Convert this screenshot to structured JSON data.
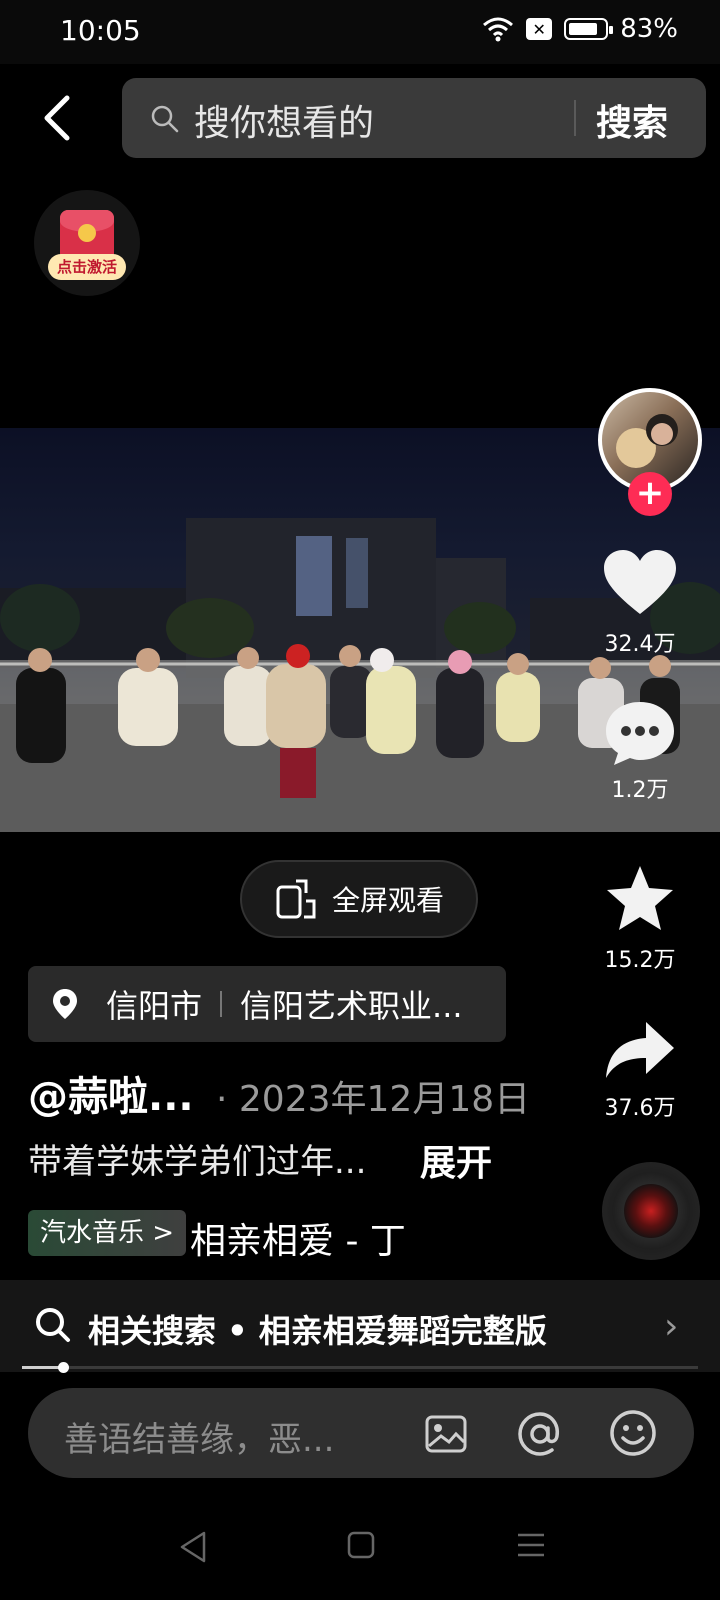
{
  "status_bar": {
    "time": "10:05",
    "battery_percent_label": "83%",
    "battery_level": 0.83
  },
  "search": {
    "placeholder": "搜你想看的",
    "button_label": "搜索"
  },
  "red_packet": {
    "label": "点击激活"
  },
  "actions": {
    "likes": "32.4万",
    "comments": "1.2万",
    "favorites": "15.2万",
    "shares": "37.6万"
  },
  "fullscreen": {
    "label": "全屏观看"
  },
  "location": {
    "city": "信阳市",
    "place": "信阳艺术职业..."
  },
  "post": {
    "author": "@蒜啦...",
    "date": "· 2023年12月18日",
    "caption": "带着学妹学弟们过年...",
    "expand_label": "展开"
  },
  "music": {
    "tag": "汽水音乐 >",
    "title": "相亲相爱 - 丁"
  },
  "related_search": {
    "text": "相关搜索 • 相亲相爱舞蹈完整版"
  },
  "playback": {
    "progress": 0.06
  },
  "comment": {
    "placeholder": "善语结善缘，恶..."
  },
  "colors": {
    "follow": "#fe2c55",
    "background": "#000000",
    "panel": "#2f2f2f"
  }
}
